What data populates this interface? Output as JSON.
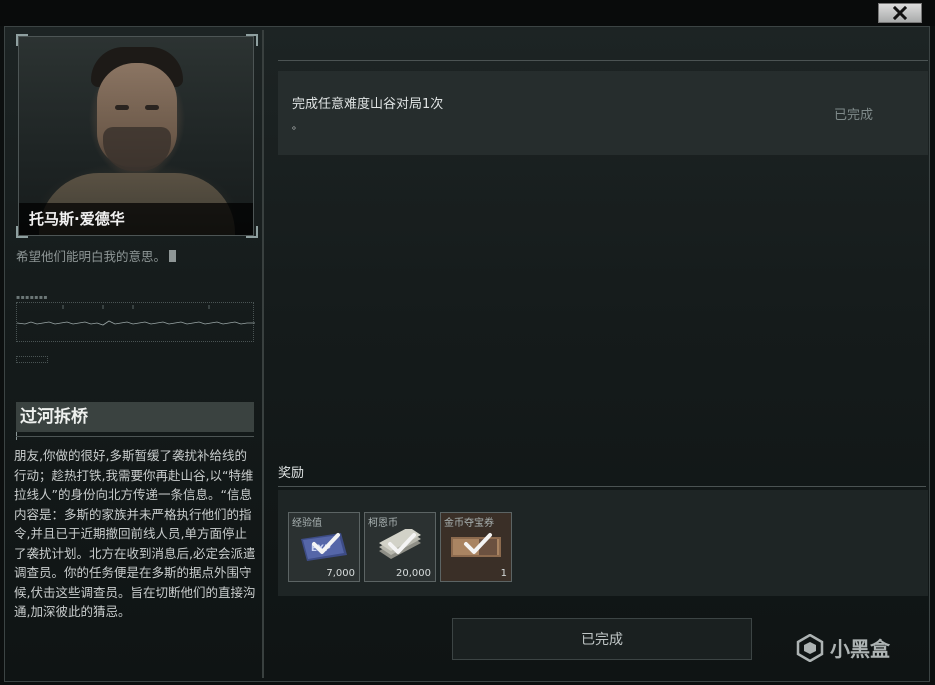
{
  "window": {
    "close_icon": "close-icon"
  },
  "character": {
    "name": "托马斯·爱德华",
    "quote": "希望他们能明白我的意思。"
  },
  "mission": {
    "title": "过河拆桥",
    "description": "朋友,你做的很好,多斯暂缓了袭扰补给线的行动；趁热打铁,我需要你再赴山谷,以“特维拉线人”的身份向北方传递一条信息。“信息内容是：多斯的家族并未严格执行他们的指令,并且已于近期撤回前线人员,单方面停止了袭扰计划。北方在收到消息后,必定会派遣调查员。你的任务便是在多斯的据点外围守候,伏击这些调查员。旨在切断他们的直接沟通,加深彼此的猜忌。"
  },
  "task": {
    "text": "完成任意难度山谷对局1次",
    "dot": "。",
    "status": "已完成"
  },
  "rewards": {
    "label": "奖励",
    "items": [
      {
        "name": "经验值",
        "qty": "7,000",
        "icon": "exp-card-icon",
        "claimed": true
      },
      {
        "name": "柯恩币",
        "qty": "20,000",
        "icon": "coin-stack-icon",
        "claimed": true
      },
      {
        "name": "金币夺宝券",
        "qty": "1",
        "icon": "ticket-icon",
        "claimed": true
      }
    ]
  },
  "complete_button": {
    "label": "已完成"
  },
  "watermark": {
    "text": "小黑盒"
  }
}
